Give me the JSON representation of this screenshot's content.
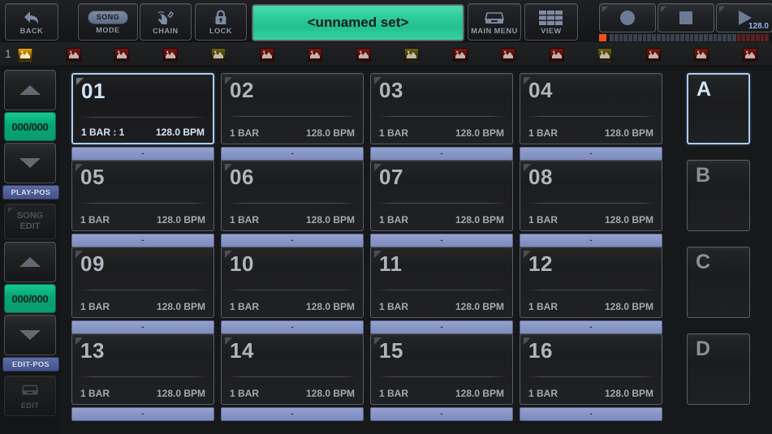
{
  "toolbar": {
    "back": {
      "label": "BACK",
      "icon": "back-arrow-icon"
    },
    "mode": {
      "label": "MODE",
      "value": "SONG",
      "icon": "song-pill"
    },
    "chain": {
      "label": "CHAIN",
      "icon": "hand-tap-link-icon"
    },
    "lock": {
      "label": "LOCK",
      "icon": "padlock-icon"
    },
    "set_name": "<unnamed set>",
    "main_menu": {
      "label": "MAIN MENU",
      "icon": "drawer-icon"
    },
    "view": {
      "label": "VIEW",
      "icon": "grid-icon"
    },
    "transport": {
      "record": {
        "icon": "record-circle-icon"
      },
      "stop": {
        "icon": "stop-square-icon"
      },
      "play": {
        "icon": "play-triangle-icon",
        "bpm": "128.0"
      }
    },
    "meter": {
      "clip_color": "#f0520f",
      "segment_color": "#39414e",
      "hot_color": "#5a1f1f",
      "total_segments": 34,
      "hot_segments": 7
    }
  },
  "track_strip": {
    "number": "1",
    "icons": [
      {
        "name": "waveform-icon",
        "color": "#f0a808",
        "active": true
      },
      {
        "name": "waveform-icon",
        "color": "#7d1511",
        "active": false
      },
      {
        "name": "waveform-icon",
        "color": "#7d1511",
        "active": false
      },
      {
        "name": "waveform-icon",
        "color": "#7d1511",
        "active": false
      },
      {
        "name": "waveform-icon",
        "color": "#6d6410",
        "active": false
      },
      {
        "name": "waveform-icon",
        "color": "#7d1511",
        "active": false
      },
      {
        "name": "waveform-icon",
        "color": "#7d1511",
        "active": false
      },
      {
        "name": "waveform-icon",
        "color": "#7d1511",
        "active": false
      },
      {
        "name": "waveform-icon",
        "color": "#6d6410",
        "active": false
      },
      {
        "name": "waveform-icon",
        "color": "#7d1511",
        "active": false
      },
      {
        "name": "waveform-icon",
        "color": "#7d1511",
        "active": false
      },
      {
        "name": "waveform-icon",
        "color": "#7d1511",
        "active": false
      },
      {
        "name": "waveform-icon",
        "color": "#6d6410",
        "active": false
      },
      {
        "name": "waveform-icon",
        "color": "#7d1511",
        "active": false
      },
      {
        "name": "waveform-icon",
        "color": "#7d1511",
        "active": false
      },
      {
        "name": "waveform-icon",
        "color": "#7d1511",
        "active": false
      }
    ]
  },
  "sidebar": {
    "play_pos": {
      "up": "▲",
      "value": "000/000",
      "down": "▼",
      "label": "PLAY-POS"
    },
    "song_edit": {
      "line1": "SONG",
      "line2": "EDIT",
      "enabled": false
    },
    "edit_pos": {
      "up": "▲",
      "value": "000/000",
      "down": "▼",
      "label": "EDIT-POS"
    },
    "edit_button": {
      "label": "EDIT",
      "icon": "drawer-icon",
      "enabled": false
    }
  },
  "grid": {
    "slot_text": "-",
    "cells": [
      {
        "num": "01",
        "bar": "1 BAR : 1",
        "bpm": "128.0 BPM",
        "selected": true
      },
      {
        "num": "02",
        "bar": "1 BAR",
        "bpm": "128.0 BPM",
        "selected": false
      },
      {
        "num": "03",
        "bar": "1 BAR",
        "bpm": "128.0 BPM",
        "selected": false
      },
      {
        "num": "04",
        "bar": "1 BAR",
        "bpm": "128.0 BPM",
        "selected": false
      },
      {
        "num": "05",
        "bar": "1 BAR",
        "bpm": "128.0 BPM",
        "selected": false
      },
      {
        "num": "06",
        "bar": "1 BAR",
        "bpm": "128.0 BPM",
        "selected": false
      },
      {
        "num": "07",
        "bar": "1 BAR",
        "bpm": "128.0 BPM",
        "selected": false
      },
      {
        "num": "08",
        "bar": "1 BAR",
        "bpm": "128.0 BPM",
        "selected": false
      },
      {
        "num": "09",
        "bar": "1 BAR",
        "bpm": "128.0 BPM",
        "selected": false
      },
      {
        "num": "10",
        "bar": "1 BAR",
        "bpm": "128.0 BPM",
        "selected": false
      },
      {
        "num": "11",
        "bar": "1 BAR",
        "bpm": "128.0 BPM",
        "selected": false
      },
      {
        "num": "12",
        "bar": "1 BAR",
        "bpm": "128.0 BPM",
        "selected": false
      },
      {
        "num": "13",
        "bar": "1 BAR",
        "bpm": "128.0 BPM",
        "selected": false
      },
      {
        "num": "14",
        "bar": "1 BAR",
        "bpm": "128.0 BPM",
        "selected": false
      },
      {
        "num": "15",
        "bar": "1 BAR",
        "bpm": "128.0 BPM",
        "selected": false
      },
      {
        "num": "16",
        "bar": "1 BAR",
        "bpm": "128.0 BPM",
        "selected": false
      }
    ]
  },
  "banks": [
    {
      "letter": "A",
      "selected": true
    },
    {
      "letter": "B",
      "selected": false
    },
    {
      "letter": "C",
      "selected": false
    },
    {
      "letter": "D",
      "selected": false
    }
  ],
  "colors": {
    "accent_green": "#2ecb9b",
    "select_blue": "#a9cdf2",
    "slot_lavender": "#8694c5",
    "pos_green": "#06a573",
    "tag_blue": "#4c5b95"
  }
}
